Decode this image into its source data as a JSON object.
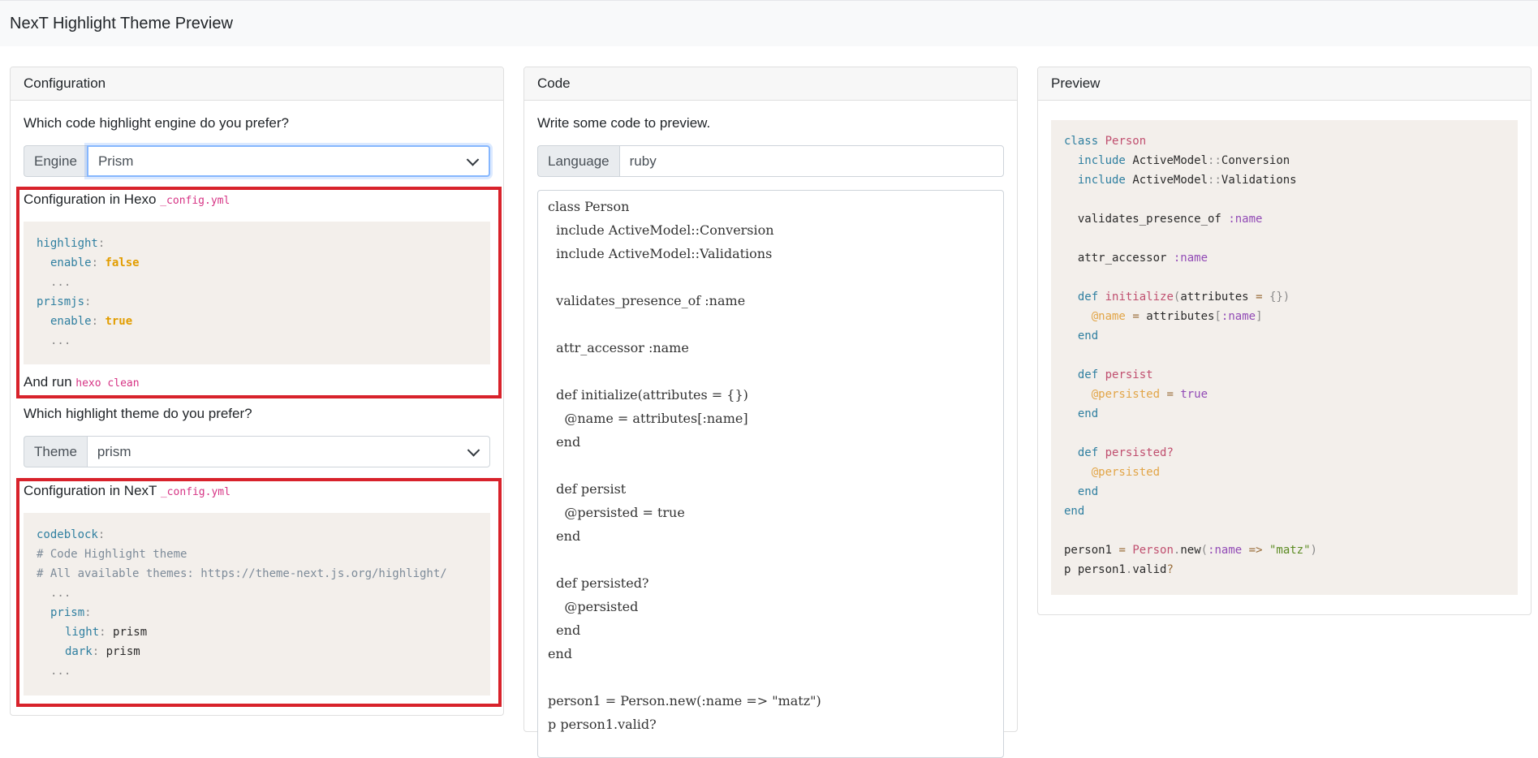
{
  "navbar": {
    "brand": "NexT Highlight Theme Preview"
  },
  "config": {
    "header": "Configuration",
    "engine_question": "Which code highlight engine do you prefer?",
    "engine_label": "Engine",
    "engine_value": "Prism",
    "hexo_config_title": "Configuration in Hexo",
    "hexo_config_file": "_config.yml",
    "hexo_snippet": {
      "l1_key": "highlight",
      "l2_key": "enable",
      "l2_val": "false",
      "l3": "...",
      "l4_key": "prismjs",
      "l5_key": "enable",
      "l5_val": "true",
      "l6": "..."
    },
    "and_run": "And run",
    "run_cmd": "hexo clean",
    "theme_question": "Which highlight theme do you prefer?",
    "theme_label": "Theme",
    "theme_value": "prism",
    "next_config_title": "Configuration in NexT",
    "next_config_file": "_config.yml",
    "next_snippet": {
      "l1_key": "codeblock",
      "l2_comment": "# Code Highlight theme",
      "l3_comment": "# All available themes: https://theme-next.js.org/highlight/",
      "l4": "...",
      "l5_key": "prism",
      "l6_key": "light",
      "l6_val": "prism",
      "l7_key": "dark",
      "l7_val": "prism",
      "l8": "..."
    }
  },
  "code": {
    "header": "Code",
    "prompt": "Write some code to preview.",
    "language_label": "Language",
    "language_value": "ruby",
    "lines": [
      "class Person",
      "  include ActiveModel::Conversion",
      "  include ActiveModel::Validations",
      "",
      "  validates_presence_of :name",
      "",
      "  attr_accessor :name",
      "",
      "  def initialize(attributes = {})",
      "    @name = attributes[:name]",
      "  end",
      "",
      "  def persist",
      "    @persisted = true",
      "  end",
      "",
      "  def persisted?",
      "    @persisted",
      "  end",
      "end",
      "",
      "person1 = Person.new(:name => \"matz\")",
      "p person1.valid?"
    ]
  },
  "preview": {
    "header": "Preview",
    "t": {
      "class": "class",
      "Person": "Person",
      "include": "include",
      "AM": "ActiveModel",
      "dc": "::",
      "Conversion": "Conversion",
      "Validations": "Validations",
      "vpo": "validates_presence_of",
      "name_sym": ":name",
      "attr_accessor": "attr_accessor",
      "def": "def",
      "initialize": "initialize",
      "lparen": "(",
      "attributes": "attributes",
      "eq": "=",
      "braces": "{}",
      "rparen": ")",
      "ivar_name": "@name",
      "lbr": "[",
      "rbr": "]",
      "end": "end",
      "persist": "persist",
      "ivar_persisted": "@persisted",
      "true": "true",
      "persisted_q": "persisted?",
      "person1": "person1",
      "dot": ".",
      "new": "new",
      "arrow": "=>",
      "matz": "\"matz\"",
      "p": "p",
      "valid": "valid",
      "qmark": "?"
    }
  }
}
